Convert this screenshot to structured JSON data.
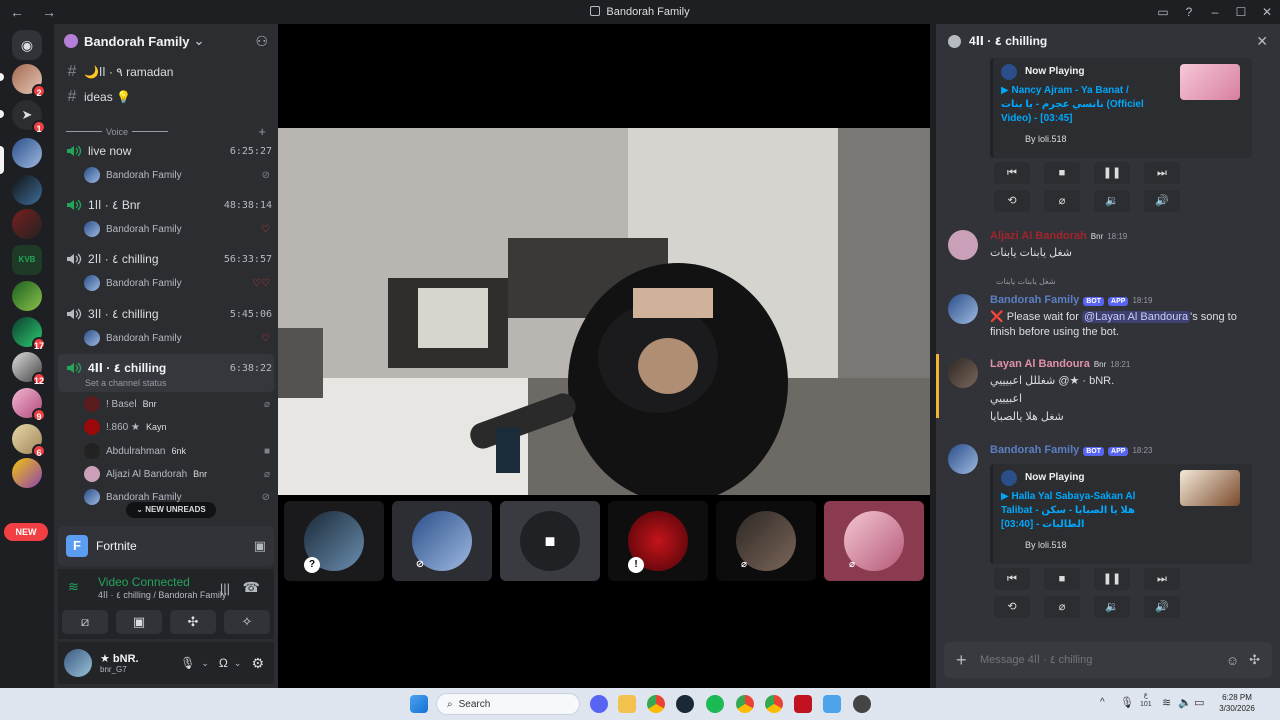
{
  "window": {
    "title": "Bandorah Family",
    "back": "←",
    "forward": "→"
  },
  "server_rail": {
    "new_label": "NEW",
    "badges": [
      "2",
      "1",
      "17",
      "12",
      "9",
      "6"
    ]
  },
  "guild": {
    "name": "Bandorah Family"
  },
  "text_channels": [
    {
      "name": "🌙٩ · اا ramadan"
    },
    {
      "name": "ideas 💡"
    }
  ],
  "voice_category": "Voice",
  "voice_channels": [
    {
      "name": "live now",
      "time": "6:25:27",
      "member": "Bandorah Family"
    },
    {
      "name": "1٤ · اا Bnr",
      "time": "48:38:14",
      "member": "Bandorah Family"
    },
    {
      "name": "2٤ · اا chilling",
      "time": "56:33:57",
      "member": "Bandorah Family"
    },
    {
      "name": "3٤ · اا chilling",
      "time": "5:45:06",
      "member": "Bandorah Family"
    },
    {
      "name": "4٤ · اا chilling",
      "time": "6:38:22",
      "status": "Set a channel status"
    }
  ],
  "active_members": [
    {
      "name": "! Basel",
      "tag": "Bnr"
    },
    {
      "name": "!.860 ★",
      "tag": "Kayn"
    },
    {
      "name": "Abdulrahman",
      "tag": "6nk"
    },
    {
      "name": "Aljazi Al Bandorah",
      "tag": "Bnr"
    },
    {
      "name": "Bandorah Family",
      "tag": ""
    },
    {
      "name": "★ . bNR.",
      "tag": "Bnr"
    }
  ],
  "new_unreads": "NEW UNREADS",
  "activity": {
    "name": "Fortnite",
    "icon": "F"
  },
  "voice_status": {
    "title": "Video Connected",
    "subtitle": "4٤ · اا chilling / Bandorah Family"
  },
  "user_panel": {
    "name": "★ bNR.",
    "sub": "bnr_G7"
  },
  "chat": {
    "channel": "4٤ · اا chilling",
    "now_playing_label": "Now Playing",
    "card1": {
      "song": "▶ Nancy Ajram - Ya Banat / نانسي عجرم - يا بنات (Officiel Video) - [03:45]",
      "by": "By loli.518"
    },
    "msg1": {
      "author": "Aljazi Al Bandorah",
      "role": "Bnr",
      "time": "18:19",
      "text": "شغل يابنات يابنات"
    },
    "msg2": {
      "reply": "شغل يابنات يابنات",
      "author": "Bandorah Family",
      "bot": "BOT",
      "app": "APP",
      "time": "18:19",
      "text1": "❌ Please wait for",
      "mention": "@Layan Al Bandoura",
      "text2": "'s song to",
      "text3": "finish before using the bot."
    },
    "msg3": {
      "author": "Layan Al Bandoura",
      "role": "Bnr",
      "time": "18:21",
      "line1": "شغللل اعبيييي @★ · bNR.",
      "line2": "اعبيييي",
      "line3": "شغل هلا يالصبايا"
    },
    "msg4": {
      "author": "Bandorah Family",
      "bot": "BOT",
      "app": "APP",
      "time": "18:23"
    },
    "card2": {
      "song": "▶ Halla Yal Sabaya-Sakan Al Talibat - هلا يا الصبايا - سكن الطالبات - [03:40]",
      "by": "By loli.518"
    },
    "composer_placeholder": "Message 4٤ · اا chilling"
  },
  "taskbar": {
    "search": "Search",
    "time": "6:28 PM",
    "date": "3/30/2026",
    "lang": "ع\n101"
  },
  "colors": {
    "accent": "#5865f2",
    "green": "#23a55a",
    "red": "#f23f43",
    "link": "#00a8fc"
  }
}
